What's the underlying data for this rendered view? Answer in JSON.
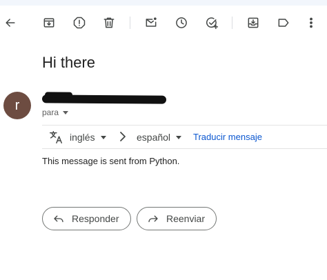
{
  "toolbar": {
    "icons": [
      "back-arrow-icon",
      "archive-icon",
      "report-spam-icon",
      "delete-icon",
      "mark-unread-icon",
      "snooze-icon",
      "add-to-tasks-icon",
      "move-to-icon",
      "label-icon",
      "more-vert-icon"
    ]
  },
  "email": {
    "subject": "Hi there",
    "sender_initial": "r",
    "sender_name": "",
    "recipient_label": "para",
    "body": "This message is sent from Python."
  },
  "translate": {
    "source_language": "inglés",
    "target_language": "español",
    "action_label": "Traducir mensaje"
  },
  "actions": {
    "reply_label": "Responder",
    "forward_label": "Reenviar"
  },
  "colors": {
    "avatar_bg": "#6d4c41",
    "link": "#0b57d0",
    "icon": "#444746"
  }
}
